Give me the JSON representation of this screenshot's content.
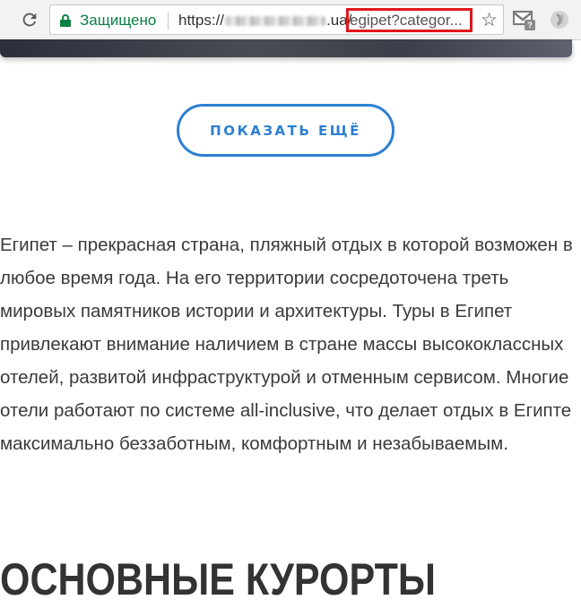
{
  "browser": {
    "security_label": "Защищено",
    "url_prefix": "https://",
    "url_domain_end": ".ua/",
    "url_highlighted": "egipet?categor..."
  },
  "page": {
    "show_more_label": "ПОКАЗАТЬ ЕЩЁ",
    "description": "Египет – прекрасная страна, пляжный отдых в которой возможен в любое время года. На его территории сосредоточена треть мировых памятников истории и архитектуры. Туры в Египет привлекают внимание наличием в стране массы высококлассных отелей, развитой инфраструктурой и отменным сервисом. Многие отели работают по системе all-inclusive, что делает отдых в Египте максимально беззаботным, комфортным и незабываемым.",
    "section_heading": "ОСНОВНЫЕ КУРОРТЫ"
  },
  "colors": {
    "accent": "#2d7fd1",
    "secure_green": "#0b8043",
    "highlight_red": "#e0161c"
  },
  "icons": {
    "reload": "reload-icon",
    "lock": "lock-icon",
    "bookmark": "star-icon",
    "gmail": "gmail-extension-icon",
    "extension": "extension-icon"
  }
}
